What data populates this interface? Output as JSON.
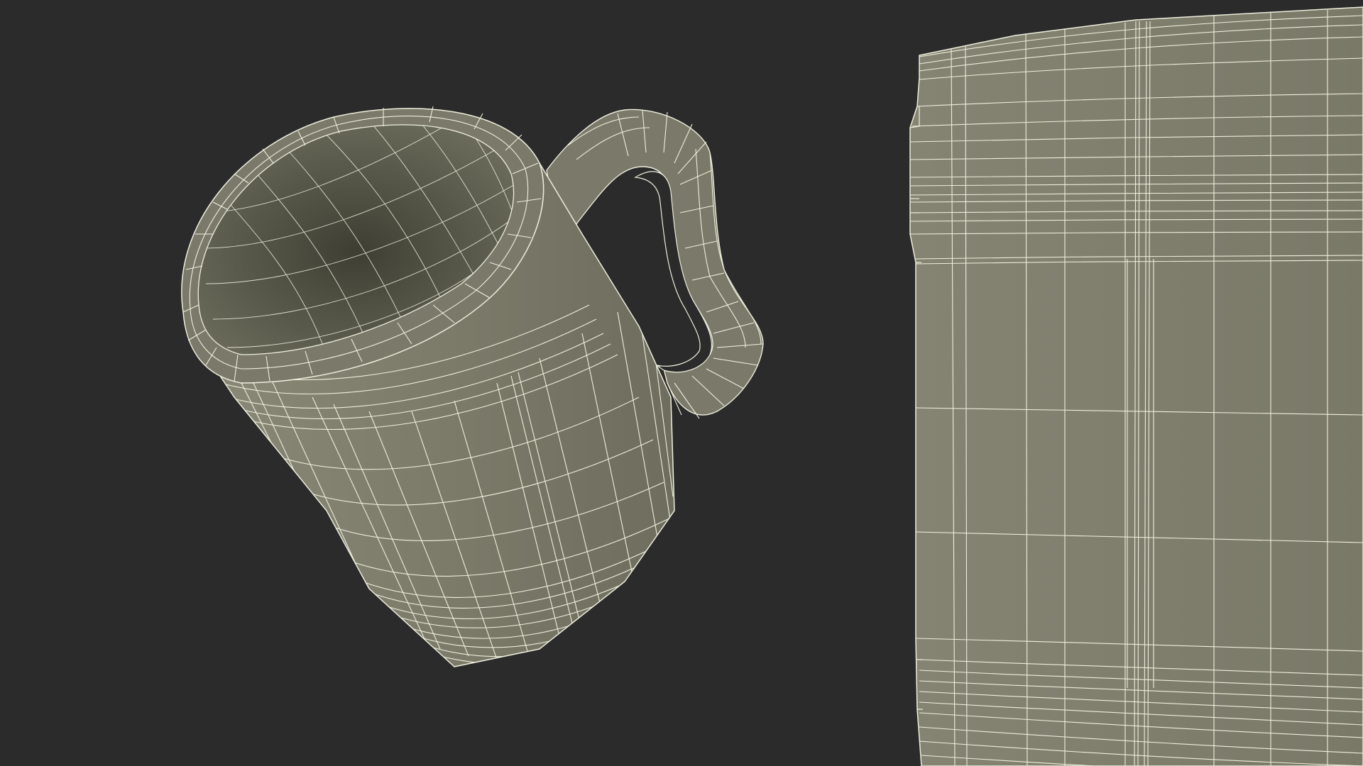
{
  "scene": {
    "background_color": "#2a2b2a",
    "surface_color": "#7b7a6a",
    "interior_color": "#4a4a3e",
    "wire_color": "#eeeedd",
    "objects": [
      {
        "name": "wooden-mug-wireframe",
        "view": "angled"
      },
      {
        "name": "mug-body-closeup-wireframe",
        "view": "front-closeup"
      }
    ]
  }
}
